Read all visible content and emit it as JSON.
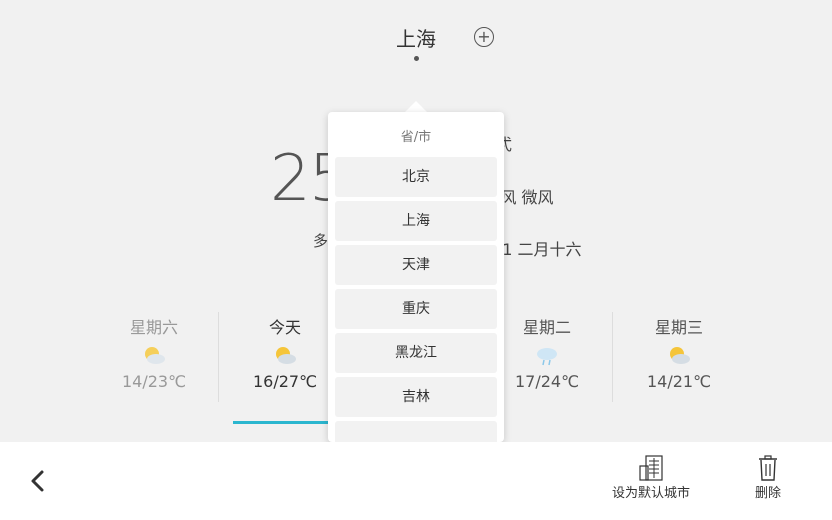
{
  "header": {
    "city": "上海",
    "add_symbol": "+"
  },
  "current": {
    "temperature": "25",
    "description": "多",
    "info_line1": "弌",
    "info_line2": "j风 微风",
    "info_line3": ")1 二月十六"
  },
  "forecast": [
    {
      "name": "星期六",
      "temp": "14/23℃",
      "icon": "partly-cloudy-icon"
    },
    {
      "name": "今天",
      "temp": "16/27℃",
      "icon": "partly-cloudy-icon"
    },
    {
      "name": "星期二",
      "temp": "17/24℃",
      "icon": "rain-icon"
    },
    {
      "name": "星期三",
      "temp": "14/21℃",
      "icon": "partly-cloudy-icon"
    }
  ],
  "dropdown": {
    "header": "省/市",
    "items": [
      "北京",
      "上海",
      "天津",
      "重庆",
      "黑龙江",
      "吉林"
    ]
  },
  "bottom": {
    "set_default": "设为默认城市",
    "delete": "删除"
  },
  "colors": {
    "accent": "#2bb6cf",
    "background": "#f1f1f1"
  }
}
